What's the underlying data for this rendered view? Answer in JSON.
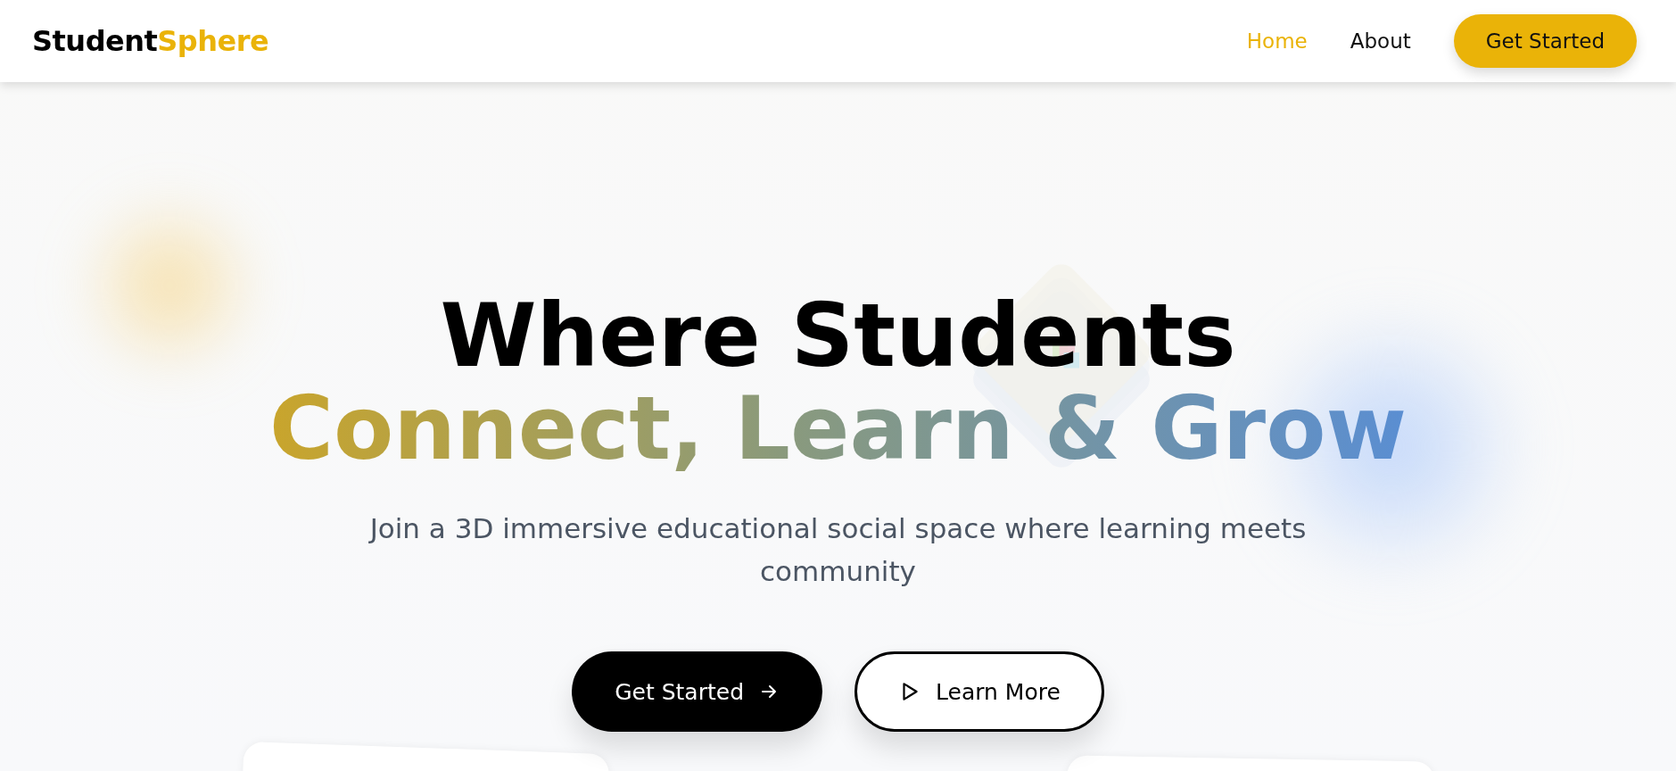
{
  "header": {
    "logo": {
      "first": "Student",
      "second": "Sphere"
    },
    "nav": [
      {
        "label": "Home",
        "selected": true
      },
      {
        "label": "About",
        "selected": false
      }
    ],
    "cta": "Get Started"
  },
  "hero": {
    "title_line_1": "Where Students",
    "title_line_2": "Connect, Learn & Grow",
    "subtitle": "Join a 3D immersive educational social space where learning meets community",
    "buttons": [
      {
        "label": "Get Started",
        "kind": "primary"
      },
      {
        "label": "Learn More",
        "kind": "secondary"
      }
    ]
  }
}
